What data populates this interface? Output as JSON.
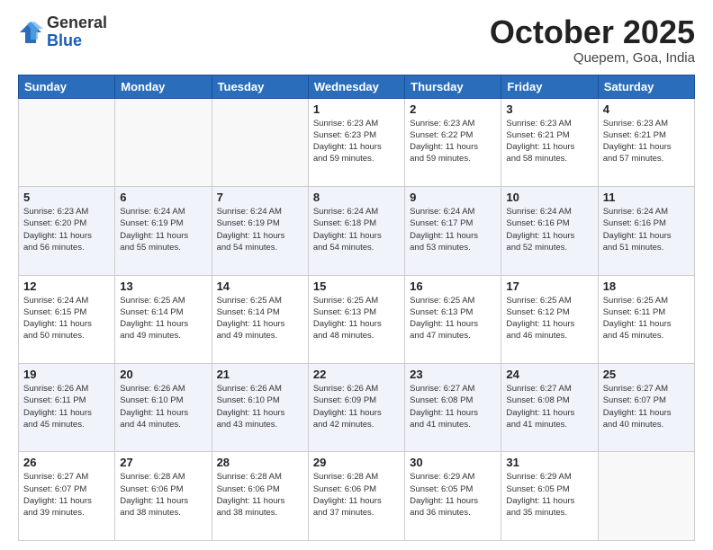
{
  "header": {
    "logo_line1": "General",
    "logo_line2": "Blue",
    "month": "October 2025",
    "location": "Quepem, Goa, India"
  },
  "weekdays": [
    "Sunday",
    "Monday",
    "Tuesday",
    "Wednesday",
    "Thursday",
    "Friday",
    "Saturday"
  ],
  "weeks": [
    [
      {
        "day": "",
        "info": ""
      },
      {
        "day": "",
        "info": ""
      },
      {
        "day": "",
        "info": ""
      },
      {
        "day": "1",
        "info": "Sunrise: 6:23 AM\nSunset: 6:23 PM\nDaylight: 11 hours\nand 59 minutes."
      },
      {
        "day": "2",
        "info": "Sunrise: 6:23 AM\nSunset: 6:22 PM\nDaylight: 11 hours\nand 59 minutes."
      },
      {
        "day": "3",
        "info": "Sunrise: 6:23 AM\nSunset: 6:21 PM\nDaylight: 11 hours\nand 58 minutes."
      },
      {
        "day": "4",
        "info": "Sunrise: 6:23 AM\nSunset: 6:21 PM\nDaylight: 11 hours\nand 57 minutes."
      }
    ],
    [
      {
        "day": "5",
        "info": "Sunrise: 6:23 AM\nSunset: 6:20 PM\nDaylight: 11 hours\nand 56 minutes."
      },
      {
        "day": "6",
        "info": "Sunrise: 6:24 AM\nSunset: 6:19 PM\nDaylight: 11 hours\nand 55 minutes."
      },
      {
        "day": "7",
        "info": "Sunrise: 6:24 AM\nSunset: 6:19 PM\nDaylight: 11 hours\nand 54 minutes."
      },
      {
        "day": "8",
        "info": "Sunrise: 6:24 AM\nSunset: 6:18 PM\nDaylight: 11 hours\nand 54 minutes."
      },
      {
        "day": "9",
        "info": "Sunrise: 6:24 AM\nSunset: 6:17 PM\nDaylight: 11 hours\nand 53 minutes."
      },
      {
        "day": "10",
        "info": "Sunrise: 6:24 AM\nSunset: 6:16 PM\nDaylight: 11 hours\nand 52 minutes."
      },
      {
        "day": "11",
        "info": "Sunrise: 6:24 AM\nSunset: 6:16 PM\nDaylight: 11 hours\nand 51 minutes."
      }
    ],
    [
      {
        "day": "12",
        "info": "Sunrise: 6:24 AM\nSunset: 6:15 PM\nDaylight: 11 hours\nand 50 minutes."
      },
      {
        "day": "13",
        "info": "Sunrise: 6:25 AM\nSunset: 6:14 PM\nDaylight: 11 hours\nand 49 minutes."
      },
      {
        "day": "14",
        "info": "Sunrise: 6:25 AM\nSunset: 6:14 PM\nDaylight: 11 hours\nand 49 minutes."
      },
      {
        "day": "15",
        "info": "Sunrise: 6:25 AM\nSunset: 6:13 PM\nDaylight: 11 hours\nand 48 minutes."
      },
      {
        "day": "16",
        "info": "Sunrise: 6:25 AM\nSunset: 6:13 PM\nDaylight: 11 hours\nand 47 minutes."
      },
      {
        "day": "17",
        "info": "Sunrise: 6:25 AM\nSunset: 6:12 PM\nDaylight: 11 hours\nand 46 minutes."
      },
      {
        "day": "18",
        "info": "Sunrise: 6:25 AM\nSunset: 6:11 PM\nDaylight: 11 hours\nand 45 minutes."
      }
    ],
    [
      {
        "day": "19",
        "info": "Sunrise: 6:26 AM\nSunset: 6:11 PM\nDaylight: 11 hours\nand 45 minutes."
      },
      {
        "day": "20",
        "info": "Sunrise: 6:26 AM\nSunset: 6:10 PM\nDaylight: 11 hours\nand 44 minutes."
      },
      {
        "day": "21",
        "info": "Sunrise: 6:26 AM\nSunset: 6:10 PM\nDaylight: 11 hours\nand 43 minutes."
      },
      {
        "day": "22",
        "info": "Sunrise: 6:26 AM\nSunset: 6:09 PM\nDaylight: 11 hours\nand 42 minutes."
      },
      {
        "day": "23",
        "info": "Sunrise: 6:27 AM\nSunset: 6:08 PM\nDaylight: 11 hours\nand 41 minutes."
      },
      {
        "day": "24",
        "info": "Sunrise: 6:27 AM\nSunset: 6:08 PM\nDaylight: 11 hours\nand 41 minutes."
      },
      {
        "day": "25",
        "info": "Sunrise: 6:27 AM\nSunset: 6:07 PM\nDaylight: 11 hours\nand 40 minutes."
      }
    ],
    [
      {
        "day": "26",
        "info": "Sunrise: 6:27 AM\nSunset: 6:07 PM\nDaylight: 11 hours\nand 39 minutes."
      },
      {
        "day": "27",
        "info": "Sunrise: 6:28 AM\nSunset: 6:06 PM\nDaylight: 11 hours\nand 38 minutes."
      },
      {
        "day": "28",
        "info": "Sunrise: 6:28 AM\nSunset: 6:06 PM\nDaylight: 11 hours\nand 38 minutes."
      },
      {
        "day": "29",
        "info": "Sunrise: 6:28 AM\nSunset: 6:06 PM\nDaylight: 11 hours\nand 37 minutes."
      },
      {
        "day": "30",
        "info": "Sunrise: 6:29 AM\nSunset: 6:05 PM\nDaylight: 11 hours\nand 36 minutes."
      },
      {
        "day": "31",
        "info": "Sunrise: 6:29 AM\nSunset: 6:05 PM\nDaylight: 11 hours\nand 35 minutes."
      },
      {
        "day": "",
        "info": ""
      }
    ]
  ]
}
